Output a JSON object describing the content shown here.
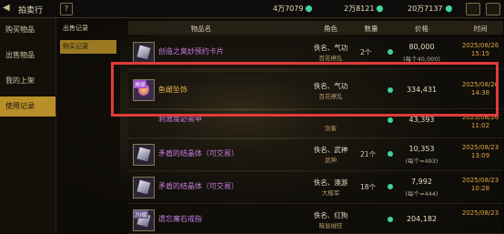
{
  "top": {
    "title": "拍卖行",
    "help": "?",
    "currency1": "4万7079",
    "currency2": "2万8121",
    "currency3": "20万7137"
  },
  "sidebar": {
    "items": [
      {
        "label": "购买物品"
      },
      {
        "label": "出售物品"
      },
      {
        "label": "我的上架"
      },
      {
        "label": "使用记录"
      }
    ]
  },
  "subnav": {
    "items": [
      {
        "label": "出售记录"
      },
      {
        "label": "购买记录"
      }
    ]
  },
  "table": {
    "headers": {
      "name": "物品名",
      "role": "角色",
      "qty": "数量",
      "price": "价格",
      "time": "时间"
    },
    "rows": [
      {
        "name": "创造之奥妙预约卡片",
        "seller": "佚名、气功",
        "guild": "百花缭乱",
        "qty": "2个",
        "price": "80,000",
        "each": "(每个40,000)",
        "date": "2025/08/26",
        "time": "15:15"
      },
      {
        "name": "鱼雌坠饰",
        "badge": "高级",
        "seller": "佚名、气功",
        "guild": "百花缭乱",
        "qty": "",
        "price": "334,431",
        "each": "",
        "date": "2025/08/26",
        "time": "14:38"
      },
      {
        "name": "刺激度必需申",
        "seller": "佚名",
        "guild": "剑客",
        "qty": "",
        "price": "43,393",
        "each": "",
        "date": "2025/08/26",
        "time": "11:02"
      },
      {
        "name": "矛盾的结晶体（可交易）",
        "seller": "佚名、武神",
        "guild": "武神",
        "qty": "21个",
        "price": "10,353",
        "each": "(每个≈493)",
        "date": "2025/08/23",
        "time": "13:09"
      },
      {
        "name": "矛盾的结晶体（可交易）",
        "seller": "佚名、澳游",
        "guild": "大楷军",
        "qty": "18个",
        "price": "7,992",
        "each": "(每个≈444)",
        "date": "2025/08/23",
        "time": "10:28"
      },
      {
        "name": "遗忘魔石戒指",
        "badge": "70级",
        "seller": "佚名、红狗",
        "guild": "暗鼠绒狂",
        "qty": "",
        "price": "204,182",
        "each": "",
        "date": "2025/08/23",
        "time": ""
      }
    ]
  }
}
